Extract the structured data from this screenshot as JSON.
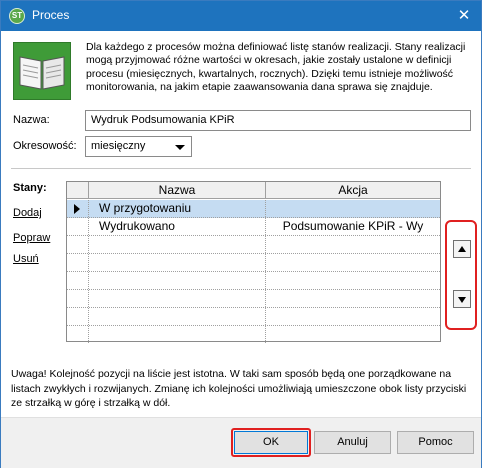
{
  "window": {
    "title": "Proces",
    "app_icon": "green-circle-logo",
    "app_icon_text": "ST",
    "close_glyph": "✕"
  },
  "intro_text": "Dla każdego z procesów można definiować listę stanów realizacji. Stany realizacji mogą przyjmować różne wartości w okresach, jakie zostały ustalone w definicji procesu (miesięcznych, kwartalnych, rocznych). Dzięki temu istnieje możliwość monitorowania, na jakim etapie zaawansowania dana sprawa się znajduje.",
  "form": {
    "name_label": "Nazwa:",
    "name_value": "Wydruk Podsumowania KPiR",
    "period_label": "Okresowość:",
    "period_value": "miesięczny"
  },
  "states": {
    "label": "Stany:",
    "links": [
      "Dodaj",
      "Popraw",
      "Usuń"
    ],
    "columns": [
      "Nazwa",
      "Akcja"
    ],
    "rows": [
      {
        "name": "W przygotowaniu",
        "action": ""
      },
      {
        "name": "Wydrukowano",
        "action": "Podsumowanie KPiR - Wy"
      }
    ]
  },
  "move_buttons": {
    "up_icon": "arrow-up-icon",
    "down_icon": "arrow-down-icon"
  },
  "warning_text": "Uwaga! Kolejność pozycji na liście jest istotna. W taki sam sposób będą one porządkowane na listach zwykłych i rozwijanych. Zmianę ich kolejności umożliwiają umieszczone obok listy przyciski ze strzałką w górę i strzałką w dół.",
  "buttons": {
    "ok": "OK",
    "cancel": "Anuluj",
    "help": "Pomoc"
  },
  "colors": {
    "titlebar": "#1e73be",
    "highlight_border": "#e02020",
    "selected_row": "#c5dcf2"
  }
}
